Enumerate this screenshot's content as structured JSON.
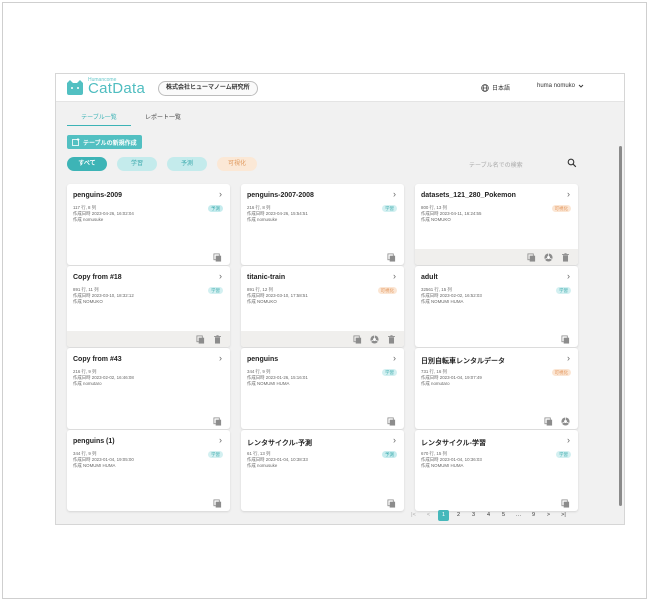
{
  "header": {
    "brand_small": "Humancome",
    "brand": "CatData",
    "company": "株式会社ヒューマノーム研究所",
    "language": "日本語",
    "user": "huma nomuko"
  },
  "tabs": [
    {
      "label": "テーブル一覧",
      "active": true
    },
    {
      "label": "レポート一覧",
      "active": false
    }
  ],
  "new_table_button": "テーブルの新規作成",
  "filters": [
    {
      "label": "すべて",
      "kind": "all"
    },
    {
      "label": "学習",
      "kind": "learn"
    },
    {
      "label": "予測",
      "kind": "predict"
    },
    {
      "label": "可視化",
      "kind": "vis"
    }
  ],
  "search": {
    "placeholder": "テーブル名での検索"
  },
  "cards": [
    {
      "title": "penguins-2009",
      "dims": "117 行, 8 列",
      "created": "作成日時 2023-04-26, 16:02:04",
      "author": "作成 nomusuke",
      "tag": "予測",
      "tag_kind": "predict",
      "actions": [
        "copy"
      ],
      "footer_gray": false
    },
    {
      "title": "penguins-2007-2008",
      "dims": "216 行, 8 列",
      "created": "作成日時 2023-04-26, 15:54:51",
      "author": "作成 nomusuke",
      "tag": "学習",
      "tag_kind": "learn",
      "actions": [
        "copy"
      ],
      "footer_gray": false
    },
    {
      "title": "datasets_121_280_Pokemon",
      "dims": "800 行, 13 列",
      "created": "作成日時 2023-04-11, 16:24:55",
      "author": "作成 NOMUKO",
      "tag": "可視化",
      "tag_kind": "vis",
      "actions": [
        "copy",
        "report",
        "delete"
      ],
      "footer_gray": true
    },
    {
      "title": "Copy from #18",
      "dims": "891 行, 11 列",
      "created": "作成日時 2023-03-10, 18:32:12",
      "author": "作成 NOMUKO",
      "tag": "学習",
      "tag_kind": "learn",
      "actions": [
        "copy",
        "delete"
      ],
      "footer_gray": true
    },
    {
      "title": "titanic-train",
      "dims": "891 行, 12 列",
      "created": "作成日時 2023-03-10, 17:58:51",
      "author": "作成 NOMUKO",
      "tag": "可視化",
      "tag_kind": "vis",
      "actions": [
        "copy",
        "report",
        "delete"
      ],
      "footer_gray": true
    },
    {
      "title": "adult",
      "dims": "32561 行, 15 列",
      "created": "作成日時 2023-02-02, 16:52:03",
      "author": "作成 NOMUMI HUMA",
      "tag": "学習",
      "tag_kind": "learn",
      "actions": [
        "copy"
      ],
      "footer_gray": false
    },
    {
      "title": "Copy from #43",
      "dims": "216 行, 9 列",
      "created": "作成日時 2023-02-02, 16:46:08",
      "author": "作成 nomutaro",
      "tag": "",
      "tag_kind": "",
      "actions": [
        "copy"
      ],
      "footer_gray": false
    },
    {
      "title": "penguins",
      "dims": "344 行, 9 列",
      "created": "作成日時 2023-01-26, 15:16:01",
      "author": "作成 NOMUMI HUMA",
      "tag": "学習",
      "tag_kind": "learn",
      "actions": [
        "copy"
      ],
      "footer_gray": false
    },
    {
      "title": "日別自転車レンタルデータ",
      "dims": "731 行, 16 列",
      "created": "作成日時 2023-01-04, 19:07:49",
      "author": "作成 nomutaro",
      "tag": "可視化",
      "tag_kind": "vis",
      "actions": [
        "copy",
        "report"
      ],
      "footer_gray": false
    },
    {
      "title": "penguins (1)",
      "dims": "344 行, 9 列",
      "created": "作成日時 2023-01-04, 19:05:00",
      "author": "作成 NOMUMI HUMA",
      "tag": "学習",
      "tag_kind": "learn",
      "actions": [
        "copy"
      ],
      "footer_gray": false
    },
    {
      "title": "レンタサイクル-予測",
      "dims": "61 行, 13 列",
      "created": "作成日時 2023-01-04, 10:38:33",
      "author": "作成 nomusuke",
      "tag": "予測",
      "tag_kind": "predict",
      "actions": [
        "copy"
      ],
      "footer_gray": false
    },
    {
      "title": "レンタサイクル-学習",
      "dims": "670 行, 15 列",
      "created": "作成日時 2023-01-04, 10:36:03",
      "author": "作成 NOMUMI HUMA",
      "tag": "学習",
      "tag_kind": "learn",
      "actions": [
        "copy"
      ],
      "footer_gray": false
    }
  ],
  "pagination": {
    "first": "|<",
    "prev": "<",
    "next": ">",
    "last": ">|",
    "pages": [
      "1",
      "2",
      "3",
      "4",
      "5",
      "…",
      "9"
    ],
    "current": "1"
  },
  "colors": {
    "accent": "#52c0c2",
    "vis_tag": "#e3955b"
  }
}
